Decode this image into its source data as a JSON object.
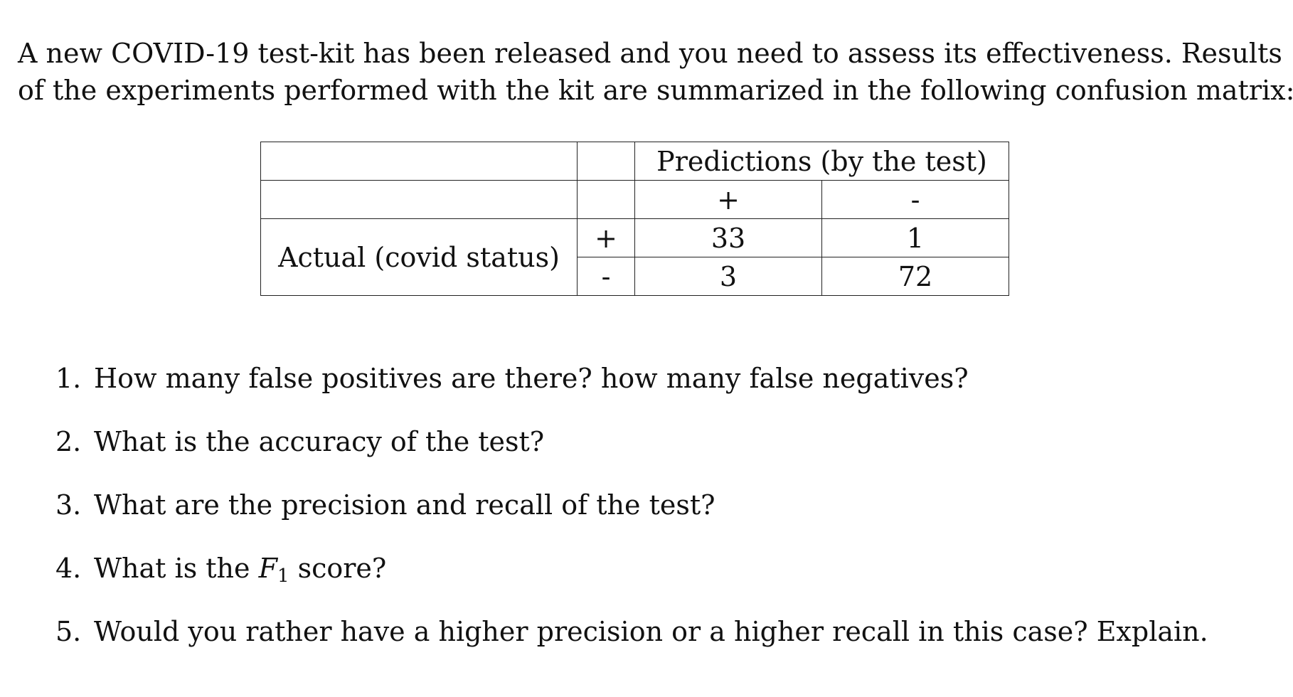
{
  "intro": {
    "line1": "A new COVID-19 test-kit has been released and you need to assess its effectiveness. Results",
    "line2": "of the experiments performed with the kit are summarized in the following confusion matrix:"
  },
  "matrix": {
    "predictions_header": "Predictions (by the test)",
    "actual_header": "Actual (covid status)",
    "pred_pos": "+",
    "pred_neg": "-",
    "actual_pos": "+",
    "actual_neg": "-",
    "tp": "33",
    "fn": "1",
    "fp": "3",
    "tn": "72"
  },
  "questions": [
    {
      "num": "1.",
      "text": "How many false positives are there? how many false negatives?"
    },
    {
      "num": "2.",
      "text": "What is the accuracy of the test?"
    },
    {
      "num": "3.",
      "text": "What are the precision and recall of the test?"
    },
    {
      "num": "4.",
      "before": "What is the ",
      "var": "F",
      "sub": "1",
      "after": " score?"
    },
    {
      "num": "5.",
      "text": "Would you rather have a higher precision or a higher recall in this case? Explain."
    }
  ]
}
